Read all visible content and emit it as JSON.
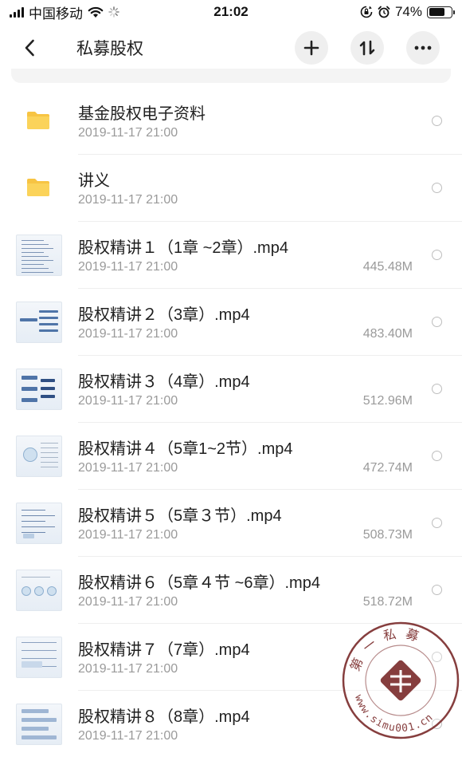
{
  "status_bar": {
    "carrier": "中国移动",
    "time": "21:02",
    "battery": "74%",
    "battery_level": 0.74
  },
  "header": {
    "title": "私募股权",
    "icons": [
      "back-icon",
      "plus-icon",
      "sort-icon",
      "more-icon"
    ]
  },
  "files": [
    {
      "name": "基金股权电子资料",
      "date": "2019-11-17 21:00",
      "size": "",
      "type": "folder"
    },
    {
      "name": "讲义",
      "date": "2019-11-17 21:00",
      "size": "",
      "type": "folder"
    },
    {
      "name": "股权精讲１（1章 ~2章）.mp4",
      "date": "2019-11-17 21:00",
      "size": "445.48M",
      "type": "video"
    },
    {
      "name": "股权精讲２（3章）.mp4",
      "date": "2019-11-17 21:00",
      "size": "483.40M",
      "type": "video"
    },
    {
      "name": "股权精讲３（4章）.mp4",
      "date": "2019-11-17 21:00",
      "size": "512.96M",
      "type": "video"
    },
    {
      "name": "股权精讲４（5章1~2节）.mp4",
      "date": "2019-11-17 21:00",
      "size": "472.74M",
      "type": "video"
    },
    {
      "name": "股权精讲５（5章３节）.mp4",
      "date": "2019-11-17 21:00",
      "size": "508.73M",
      "type": "video"
    },
    {
      "name": "股权精讲６（5章４节 ~6章）.mp4",
      "date": "2019-11-17 21:00",
      "size": "518.72M",
      "type": "video"
    },
    {
      "name": "股权精讲７（7章）.mp4",
      "date": "2019-11-17 21:00",
      "size": "",
      "type": "video"
    },
    {
      "name": "股权精讲８（8章）.mp4",
      "date": "2019-11-17 21:00",
      "size": "",
      "type": "video"
    }
  ],
  "watermark": {
    "text_top": "第一私募",
    "text_bottom": "www.simu001.cn",
    "color": "#7a2a2a"
  },
  "colors": {
    "folder": "#f7c443",
    "secondary_text": "#9a9a9a",
    "button_bg": "#efefef"
  }
}
